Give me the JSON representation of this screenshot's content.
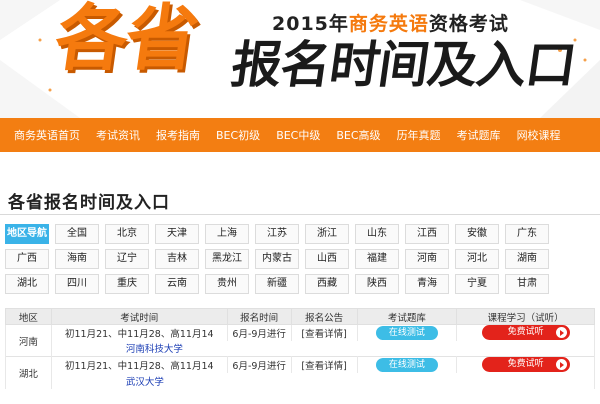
{
  "banner": {
    "subtitle_prefix": "2015年",
    "subtitle_highlight": "商务英语",
    "subtitle_suffix": "资格考试",
    "big_orange": "各省",
    "big_black": "报名时间及入口"
  },
  "nav": {
    "items": [
      "商务英语首页",
      "考试资讯",
      "报考指南",
      "BEC初级",
      "BEC中级",
      "BEC高级",
      "历年真题",
      "考试题库",
      "网校课程"
    ]
  },
  "page_title": "各省报名时间及入口",
  "regions": {
    "head": "地区导航",
    "items": [
      "全国",
      "北京",
      "天津",
      "上海",
      "江苏",
      "浙江",
      "山东",
      "江西",
      "安徽",
      "广东",
      "广西",
      "海南",
      "辽宁",
      "吉林",
      "黑龙江",
      "内蒙古",
      "山西",
      "福建",
      "河南",
      "河北",
      "湖南",
      "湖北",
      "四川",
      "重庆",
      "云南",
      "贵州",
      "新疆",
      "西藏",
      "陕西",
      "青海",
      "宁夏",
      "甘肃"
    ]
  },
  "table": {
    "headers": [
      "地区",
      "考试时间",
      "报名时间",
      "报名公告",
      "考试题库",
      "课程学习（试听）"
    ],
    "rows": [
      {
        "region": "河南",
        "exam_time": "初11月21、中11月28、高11月14",
        "signup": "6月-9月进行",
        "notice": "[查看详情]",
        "test": "在线测试",
        "free": "免费试听",
        "uni": "河南科技大学"
      },
      {
        "region": "湖北",
        "exam_time": "初11月21、中11月28、高11月14",
        "signup": "6月-9月进行",
        "notice": "[查看详情]",
        "test": "在线测试",
        "free": "免费试听",
        "uni": "武汉大学"
      }
    ]
  },
  "colors": {
    "accent": "#f37e12",
    "blue": "#3ab3e8",
    "red": "#e3231b"
  }
}
